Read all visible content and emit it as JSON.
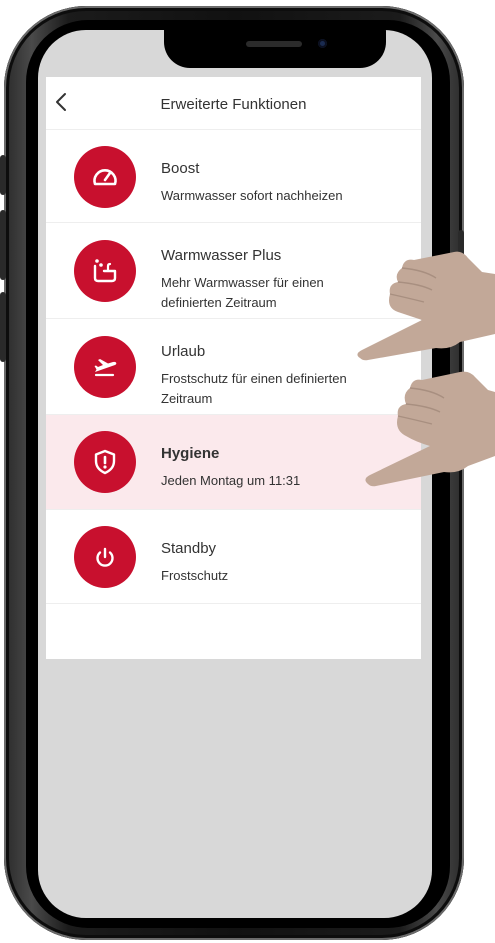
{
  "header": {
    "title": "Erweiterte Funktionen",
    "back_icon": "chevron-left-icon"
  },
  "colors": {
    "accent": "#c8102e",
    "active_row": "#fbe9ec",
    "hand": "#c2a898"
  },
  "features": [
    {
      "title": "Boost",
      "subtitle": "Warmwasser sofort nachheizen",
      "icon": "speedometer-icon",
      "active": false
    },
    {
      "title": "Warmwasser Plus",
      "subtitle": "Mehr Warmwasser für einen definierten Zeitraum",
      "icon": "bathtub-icon",
      "active": false
    },
    {
      "title": "Urlaub",
      "subtitle": "Frostschutz für einen definierten Zeitraum",
      "icon": "airplane-icon",
      "active": false
    },
    {
      "title": "Hygiene",
      "subtitle": "Jeden Montag um 11:31",
      "icon": "shield-alert-icon",
      "active": true
    },
    {
      "title": "Standby",
      "subtitle": "Frostschutz",
      "icon": "power-icon",
      "active": false
    }
  ]
}
